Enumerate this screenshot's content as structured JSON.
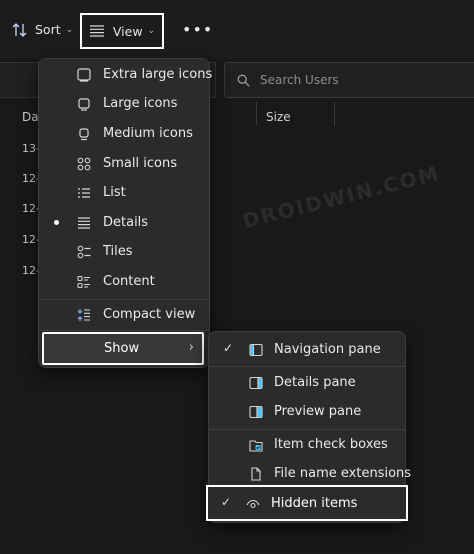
{
  "toolbar": {
    "sort_label": "Sort",
    "view_label": "View",
    "more_label": "•••"
  },
  "search": {
    "placeholder": "Search Users"
  },
  "columns": {
    "date_label": "Da",
    "size_label": "Size"
  },
  "rows": [
    "13-",
    "12-",
    "12-",
    "12-",
    "12-"
  ],
  "watermark": "DROIDWIN.COM",
  "view_menu": {
    "items": [
      {
        "label": "Extra large icons",
        "icon": "extra-large-icons-icon"
      },
      {
        "label": "Large icons",
        "icon": "large-icons-icon"
      },
      {
        "label": "Medium icons",
        "icon": "medium-icons-icon"
      },
      {
        "label": "Small icons",
        "icon": "small-icons-icon"
      },
      {
        "label": "List",
        "icon": "list-icon"
      },
      {
        "label": "Details",
        "icon": "details-icon",
        "selected": true
      },
      {
        "label": "Tiles",
        "icon": "tiles-icon"
      },
      {
        "label": "Content",
        "icon": "content-icon"
      }
    ],
    "compact_label": "Compact view",
    "show_label": "Show"
  },
  "show_menu": {
    "items": [
      {
        "label": "Navigation pane",
        "icon": "navigation-pane-icon",
        "checked": true
      },
      {
        "label": "Details pane",
        "icon": "details-pane-icon",
        "checked": false
      },
      {
        "label": "Preview pane",
        "icon": "preview-pane-icon",
        "checked": false
      },
      {
        "label": "Item check boxes",
        "icon": "item-check-boxes-icon",
        "checked": false
      },
      {
        "label": "File name extensions",
        "icon": "file-name-extensions-icon",
        "checked": false
      },
      {
        "label": "Hidden items",
        "icon": "hidden-items-icon",
        "checked": true
      }
    ]
  },
  "colors": {
    "background": "#191919",
    "menu": "#2b2b2b",
    "accent": "#4cc2ff",
    "highlight_border": "#ffffff"
  }
}
